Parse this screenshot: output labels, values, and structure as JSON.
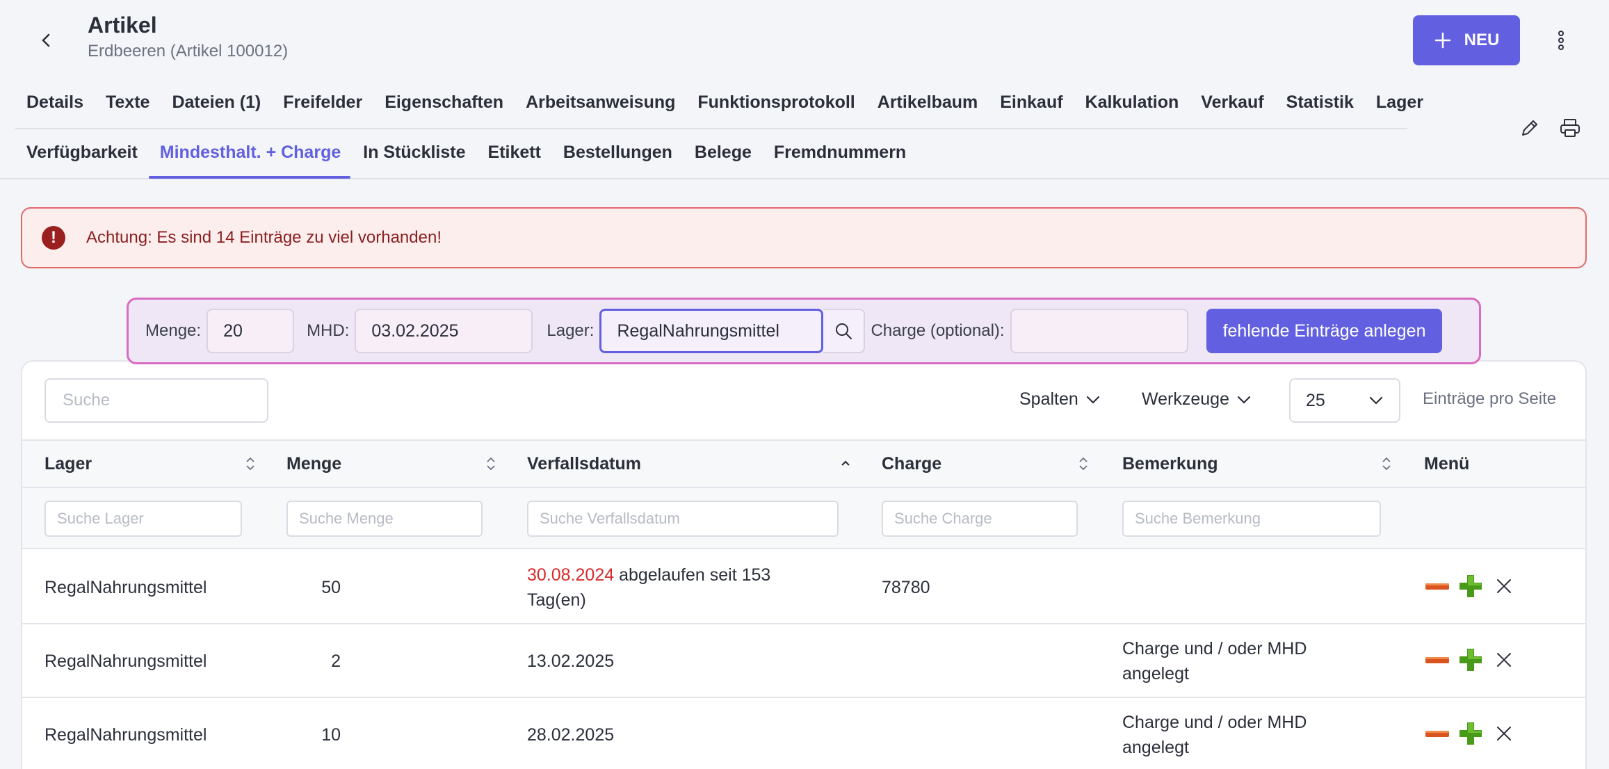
{
  "header": {
    "title": "Artikel",
    "subtitle": "Erdbeeren (Artikel 100012)",
    "new_label": "NEU"
  },
  "tabs_row1": [
    "Details",
    "Texte",
    "Dateien (1)",
    "Freifelder",
    "Eigenschaften",
    "Arbeitsanweisung",
    "Funktionsprotokoll",
    "Artikelbaum",
    "Einkauf",
    "Kalkulation",
    "Verkauf",
    "Statistik",
    "Lager"
  ],
  "tabs_row2": [
    "Verfügbarkeit",
    "Mindesthalt. + Charge",
    "In Stückliste",
    "Etikett",
    "Bestellungen",
    "Belege",
    "Fremdnummern"
  ],
  "active_tab": "Mindesthalt. + Charge",
  "alert": {
    "text": "Achtung: Es sind 14 Einträge zu viel vorhanden!",
    "icon": "exclamation-icon"
  },
  "form": {
    "menge_label": "Menge:",
    "menge_value": "20",
    "mhd_label": "MHD:",
    "mhd_value": "03.02.2025",
    "lager_label": "Lager:",
    "lager_value": "RegalNahrungsmittel",
    "charge_label": "Charge (optional):",
    "charge_value": "",
    "submit_label": "fehlende Einträge anlegen"
  },
  "toolbar": {
    "search_placeholder": "Suche",
    "columns_label": "Spalten",
    "tools_label": "Werkzeuge",
    "per_page_value": "25",
    "per_page_label": "Einträge pro Seite"
  },
  "table": {
    "headers": {
      "lager": "Lager",
      "menge": "Menge",
      "verfallsdatum": "Verfallsdatum",
      "charge": "Charge",
      "bemerkung": "Bemerkung",
      "menu": "Menü"
    },
    "filters": {
      "lager": "Suche Lager",
      "menge": "Suche Menge",
      "verfallsdatum": "Suche Verfallsdatum",
      "charge": "Suche Charge",
      "bemerkung": "Suche Bemerkung"
    },
    "rows": [
      {
        "lager": "RegalNahrungsmittel",
        "menge": "50",
        "date": "30.08.2024",
        "date_suffix": " abgelaufen seit 153 Tag(en)",
        "charge": "78780",
        "bemerkung": ""
      },
      {
        "lager": "RegalNahrungsmittel",
        "menge": "2",
        "date": "13.02.2025",
        "date_suffix": "",
        "charge": "",
        "bemerkung": "Charge und / oder MHD angelegt"
      },
      {
        "lager": "RegalNahrungsmittel",
        "menge": "10",
        "date": "28.02.2025",
        "date_suffix": "",
        "charge": "",
        "bemerkung": "Charge und / oder MHD angelegt"
      }
    ]
  },
  "colors": {
    "accent": "#6260e0",
    "alert_bg": "#fdeeee",
    "alert_border": "#e06a6a",
    "expired": "#d92b2b",
    "minus": "#d9541e",
    "plus": "#4a9a1a"
  }
}
